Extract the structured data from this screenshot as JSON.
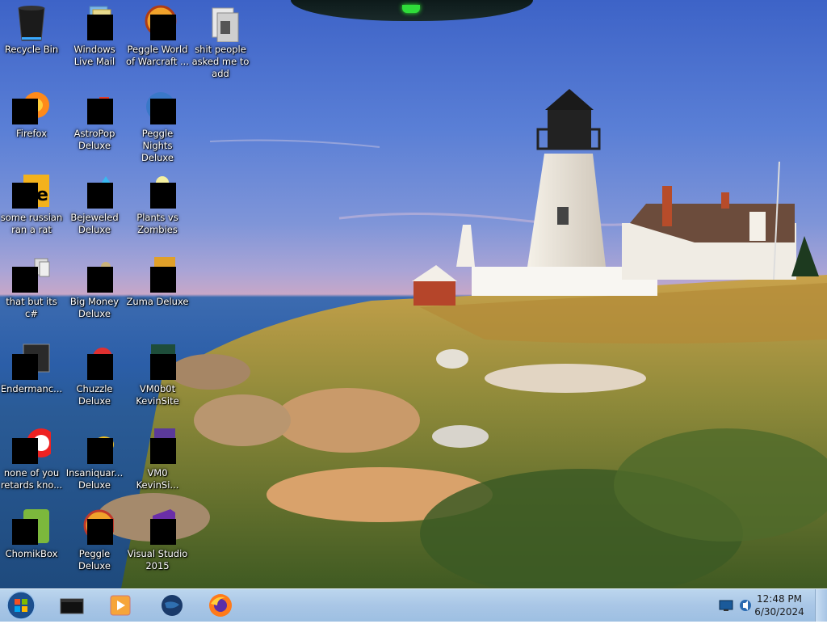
{
  "desktop": {
    "icons": [
      {
        "label": "Recycle Bin",
        "icon": "recycle-bin-icon"
      },
      {
        "label": "Windows Live Mail",
        "icon": "mail-icon"
      },
      {
        "label": "Peggle World of Warcraft ...",
        "icon": "peggle-icon"
      },
      {
        "label": "shit people asked me to add",
        "icon": "folder-icon"
      },
      {
        "label": "Firefox",
        "icon": "firefox-icon"
      },
      {
        "label": "AstroPop Deluxe",
        "icon": "astropop-icon"
      },
      {
        "label": "Peggle Nights Deluxe",
        "icon": "peggle-nights-icon"
      },
      {
        "label": "some russian ran a rat",
        "icon": "app-icon"
      },
      {
        "label": "Bejeweled Deluxe",
        "icon": "bejeweled-icon"
      },
      {
        "label": "Plants vs Zombies",
        "icon": "plants-vs-zombies-icon"
      },
      {
        "label": "that but its c#",
        "icon": "document-stack-icon"
      },
      {
        "label": "Big Money Deluxe",
        "icon": "money-bag-icon"
      },
      {
        "label": "Zuma Deluxe",
        "icon": "zuma-icon"
      },
      {
        "label": "Endermanc...",
        "icon": "console-icon"
      },
      {
        "label": "Chuzzle Deluxe",
        "icon": "chuzzle-icon"
      },
      {
        "label": "VM0b0t KevinSite",
        "icon": "vm-icon"
      },
      {
        "label": "none of you retards kno...",
        "icon": "opera-icon"
      },
      {
        "label": "Insaniquar... Deluxe",
        "icon": "fish-icon"
      },
      {
        "label": "VM0 KevinSi...",
        "icon": "vm-icon"
      },
      {
        "label": "ChomikBox",
        "icon": "chomikbox-icon"
      },
      {
        "label": "Peggle Deluxe",
        "icon": "peggle-icon"
      },
      {
        "label": "Visual Studio 2015",
        "icon": "visual-studio-icon"
      }
    ]
  },
  "taskbar": {
    "pinned": [
      {
        "icon": "windows-start-icon"
      },
      {
        "icon": "cmd-icon"
      },
      {
        "icon": "media-player-icon"
      },
      {
        "icon": "globe-icon"
      },
      {
        "icon": "firefox-icon"
      }
    ],
    "clock": {
      "time": "12:48 PM",
      "date": "6/30/2024"
    }
  },
  "colors": {
    "sky_top": "#3d63c7",
    "sea": "#2b5ea8",
    "taskbar": "#a9c6e6",
    "gadget_light": "#2fdc3a"
  }
}
